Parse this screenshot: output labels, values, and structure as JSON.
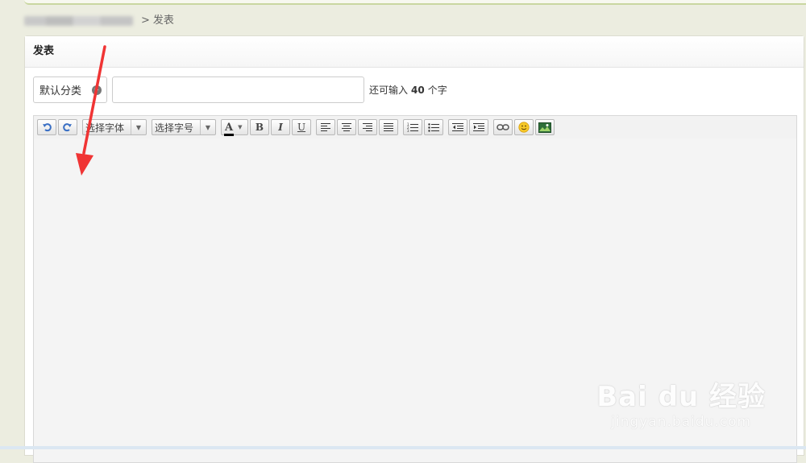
{
  "breadcrumb": {
    "current": "发表",
    "separator": ">"
  },
  "panel": {
    "title": "发表"
  },
  "form": {
    "category_label": "默认分类",
    "title_value": "",
    "counter_prefix": "还可输入",
    "counter_value": "40",
    "counter_suffix": "个字"
  },
  "toolbar": {
    "font_family_placeholder": "选择字体",
    "font_size_placeholder": "选择字号",
    "font_color_label": "A",
    "bold_label": "B",
    "italic_label": "I",
    "underline_label": "U",
    "icons": [
      "undo-icon",
      "redo-icon",
      "font-color-icon",
      "align-left-icon",
      "align-center-icon",
      "align-right-icon",
      "align-justify-icon",
      "ordered-list-icon",
      "unordered-list-icon",
      "outdent-icon",
      "indent-icon",
      "link-icon",
      "emoticon-icon",
      "image-icon"
    ]
  },
  "colors": {
    "annotation_arrow": "#f03434",
    "font_color": "#000000",
    "background": "#ecede0"
  },
  "watermark": {
    "main": "Bai du 经验",
    "sub": "jingyan.baidu.com"
  }
}
